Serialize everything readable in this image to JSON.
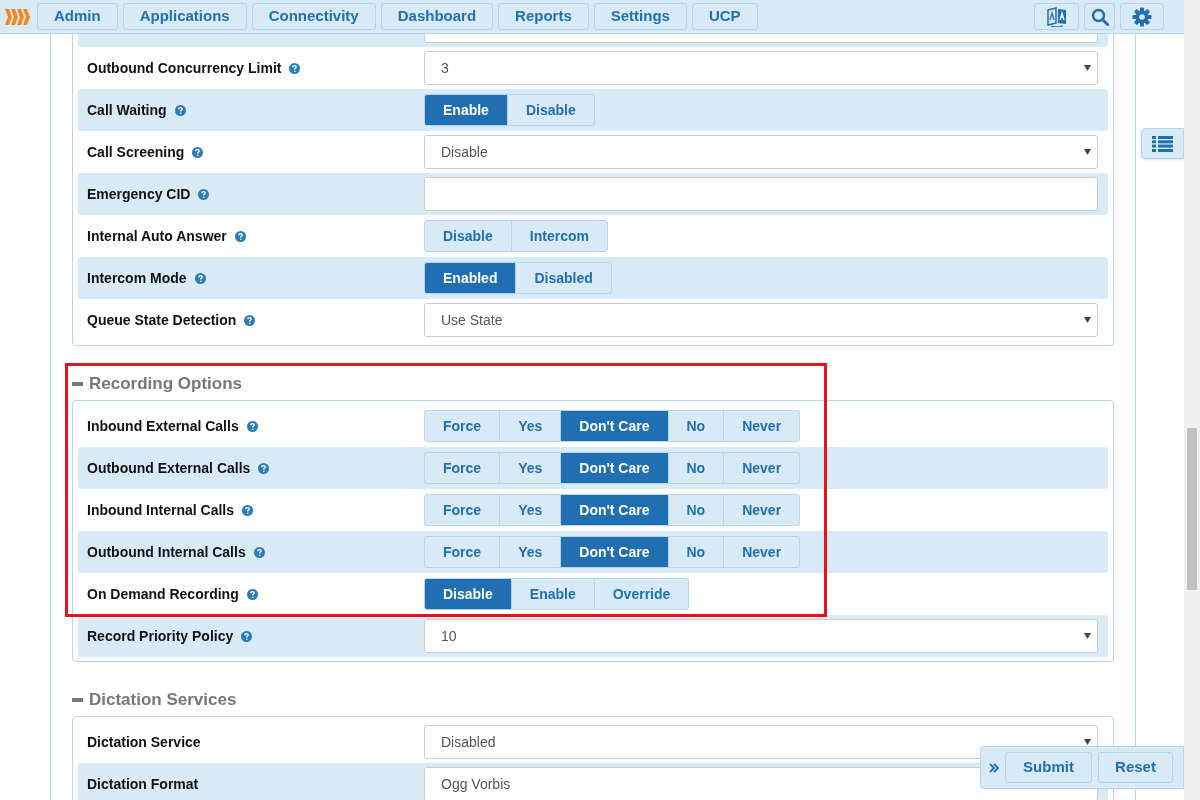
{
  "nav": {
    "items": [
      "Admin",
      "Applications",
      "Connectivity",
      "Dashboard",
      "Reports",
      "Settings",
      "UCP"
    ]
  },
  "sections": [
    {
      "rows": [
        {
          "kind": "text",
          "value": ""
        },
        {
          "label": "Outbound Concurrency Limit",
          "kind": "select",
          "value": "3"
        },
        {
          "label": "Call Waiting",
          "kind": "radio",
          "options": [
            {
              "label": "Enable",
              "selected": true
            },
            {
              "label": "Disable",
              "selected": false
            }
          ]
        },
        {
          "label": "Call Screening",
          "kind": "select",
          "value": "Disable"
        },
        {
          "label": "Emergency CID",
          "kind": "text",
          "value": ""
        },
        {
          "label": "Internal Auto Answer",
          "kind": "radio",
          "options": [
            {
              "label": "Disable",
              "selected": false
            },
            {
              "label": "Intercom",
              "selected": false
            }
          ]
        },
        {
          "label": "Intercom Mode",
          "kind": "radio",
          "options": [
            {
              "label": "Enabled",
              "selected": true
            },
            {
              "label": "Disabled",
              "selected": false
            }
          ]
        },
        {
          "label": "Queue State Detection",
          "kind": "select",
          "value": "Use State"
        }
      ]
    },
    {
      "title": "Recording Options",
      "highlighted": true,
      "rows": [
        {
          "label": "Inbound External Calls",
          "kind": "radio",
          "options": [
            {
              "label": "Force",
              "selected": false
            },
            {
              "label": "Yes",
              "selected": false
            },
            {
              "label": "Don't Care",
              "selected": true
            },
            {
              "label": "No",
              "selected": false
            },
            {
              "label": "Never",
              "selected": false
            }
          ]
        },
        {
          "label": "Outbound External Calls",
          "kind": "radio",
          "options": [
            {
              "label": "Force",
              "selected": false
            },
            {
              "label": "Yes",
              "selected": false
            },
            {
              "label": "Don't Care",
              "selected": true
            },
            {
              "label": "No",
              "selected": false
            },
            {
              "label": "Never",
              "selected": false
            }
          ]
        },
        {
          "label": "Inbound Internal Calls",
          "kind": "radio",
          "options": [
            {
              "label": "Force",
              "selected": false
            },
            {
              "label": "Yes",
              "selected": false
            },
            {
              "label": "Don't Care",
              "selected": true
            },
            {
              "label": "No",
              "selected": false
            },
            {
              "label": "Never",
              "selected": false
            }
          ]
        },
        {
          "label": "Outbound Internal Calls",
          "kind": "radio",
          "options": [
            {
              "label": "Force",
              "selected": false
            },
            {
              "label": "Yes",
              "selected": false
            },
            {
              "label": "Don't Care",
              "selected": true
            },
            {
              "label": "No",
              "selected": false
            },
            {
              "label": "Never",
              "selected": false
            }
          ]
        },
        {
          "label": "On Demand Recording",
          "kind": "radio",
          "options": [
            {
              "label": "Disable",
              "selected": true
            },
            {
              "label": "Enable",
              "selected": false
            },
            {
              "label": "Override",
              "selected": false
            }
          ]
        },
        {
          "label": "Record Priority Policy",
          "kind": "select",
          "value": "10"
        }
      ]
    },
    {
      "title": "Dictation Services",
      "highlighted": false,
      "rows": [
        {
          "label": "Dictation Service",
          "kind": "select",
          "value": "Disabled",
          "help": false
        },
        {
          "label": "Dictation Format",
          "kind": "select",
          "value": "Ogg Vorbis",
          "help": false
        }
      ]
    }
  ],
  "action_bar": {
    "buttons": [
      "Submit",
      "Reset"
    ]
  }
}
